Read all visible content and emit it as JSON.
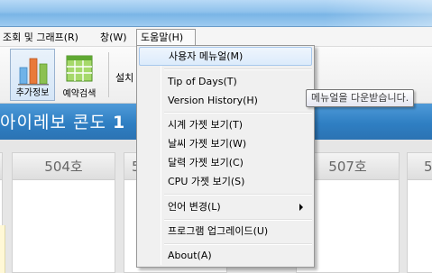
{
  "menubar": {
    "items": [
      {
        "label": "조회 및 그래프(R)"
      },
      {
        "label": "창(W)"
      },
      {
        "label": "도움말(H)"
      }
    ]
  },
  "toolbar": {
    "tools": [
      {
        "label": "추가정보",
        "icon": "bar-chart-icon"
      },
      {
        "label": "예약검색",
        "icon": "spreadsheet-icon"
      }
    ],
    "settings_text": "설치"
  },
  "banner": {
    "text": "아이레보 콘도",
    "bold_suffix": "1"
  },
  "rooms": [
    {
      "label": "504호"
    },
    {
      "label": "5"
    },
    {
      "label": "507호"
    },
    {
      "label": "5"
    }
  ],
  "help_menu": {
    "items": [
      {
        "label": "사용자 메뉴얼(M)"
      },
      {
        "label": "Tip of Days(T)"
      },
      {
        "label": "Version History(H)"
      },
      {
        "label": "시계 가젯 보기(T)"
      },
      {
        "label": "날씨 가젯 보기(W)"
      },
      {
        "label": "달력 가젯 보기(C)"
      },
      {
        "label": "CPU 가젯 보기(S)"
      },
      {
        "label": "언어 변경(L)"
      },
      {
        "label": "프로그램 업그레이드(U)"
      },
      {
        "label": "About(A)"
      }
    ]
  },
  "tooltip": {
    "text": "메뉴얼을 다운받습니다."
  },
  "colors": {
    "title_bar": "#8fc2ec",
    "banner": "#2f7fc3",
    "menu_highlight": "#dcebfb"
  }
}
